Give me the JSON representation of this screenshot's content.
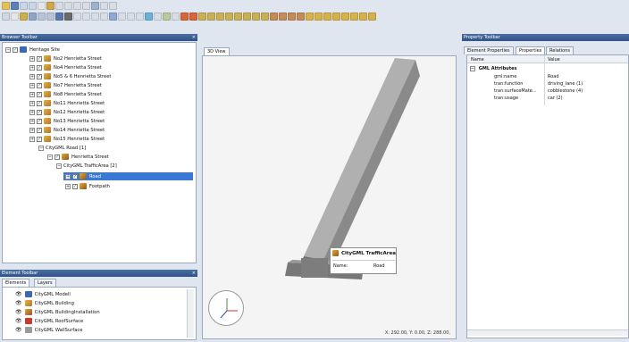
{
  "colors": {
    "titlebar": "#2f5387",
    "selection": "#3a78d6",
    "viewport_bg": "#f4f4f4",
    "model": "#8f8f8f"
  },
  "browser_toolbar": {
    "title": "Browser Toolbar",
    "close": "×",
    "items": [
      {
        "label": "Heritage Site",
        "icon": "city-icon"
      },
      {
        "label": "No2 Henrietta Street",
        "icon": "building-icon"
      },
      {
        "label": "No4 Henrietta Street",
        "icon": "building-icon"
      },
      {
        "label": "No5 & 6 Henrietta Street",
        "icon": "building-icon"
      },
      {
        "label": "No7 Henrietta Street",
        "icon": "building-icon"
      },
      {
        "label": "No8 Henrietta Street",
        "icon": "building-icon"
      },
      {
        "label": "No11 Henrietta Street",
        "icon": "building-icon"
      },
      {
        "label": "No12 Henrietta Street",
        "icon": "building-icon"
      },
      {
        "label": "No13 Henrietta Street",
        "icon": "building-icon"
      },
      {
        "label": "No14 Henrietta Street",
        "icon": "building-icon"
      },
      {
        "label": "No15 Henrietta Street",
        "icon": "building-icon"
      },
      {
        "label": "CityGML Road [1]",
        "icon": ""
      },
      {
        "label": "Henrietta Street",
        "icon": "road-icon"
      },
      {
        "label": "CityGML TrafficArea [2]",
        "icon": ""
      },
      {
        "label": "Road",
        "icon": "road-icon"
      },
      {
        "label": "Footpath",
        "icon": "road-icon"
      }
    ]
  },
  "element_toolbar": {
    "title": "Element Toolbar",
    "close": "×",
    "tabs": [
      "Elements",
      "Layers"
    ],
    "items": [
      {
        "label": "CityGML Modell",
        "icon": "model-icon"
      },
      {
        "label": "CityGML Building",
        "icon": "building-icon"
      },
      {
        "label": "CityGML BuildingInstallation",
        "icon": "installation-icon"
      },
      {
        "label": "CityGML RoofSurface",
        "icon": "roof-icon"
      },
      {
        "label": "CityGML WallSurface",
        "icon": "wall-icon"
      }
    ]
  },
  "view3d": {
    "tab": "3D View",
    "coords": "X: 292.00, Y: 0.00, Z: 288.00,",
    "tooltip": {
      "title": "CityGML TrafficArea",
      "name_label": "Name:",
      "name_value": "Road"
    }
  },
  "property_toolbar": {
    "title": "Property Toolbar",
    "tabs": [
      "Element Properties",
      "Properties",
      "Relations"
    ],
    "columns": [
      "Name",
      "Value"
    ],
    "group": "GML Attributes",
    "rows": [
      {
        "name": "gml:name",
        "value": "Road"
      },
      {
        "name": "tran:function",
        "value": "driving_lane (1)"
      },
      {
        "name": "tran:surfaceMate...",
        "value": "cobblestone (4)"
      },
      {
        "name": "tran:usage",
        "value": "car (2)"
      }
    ]
  }
}
